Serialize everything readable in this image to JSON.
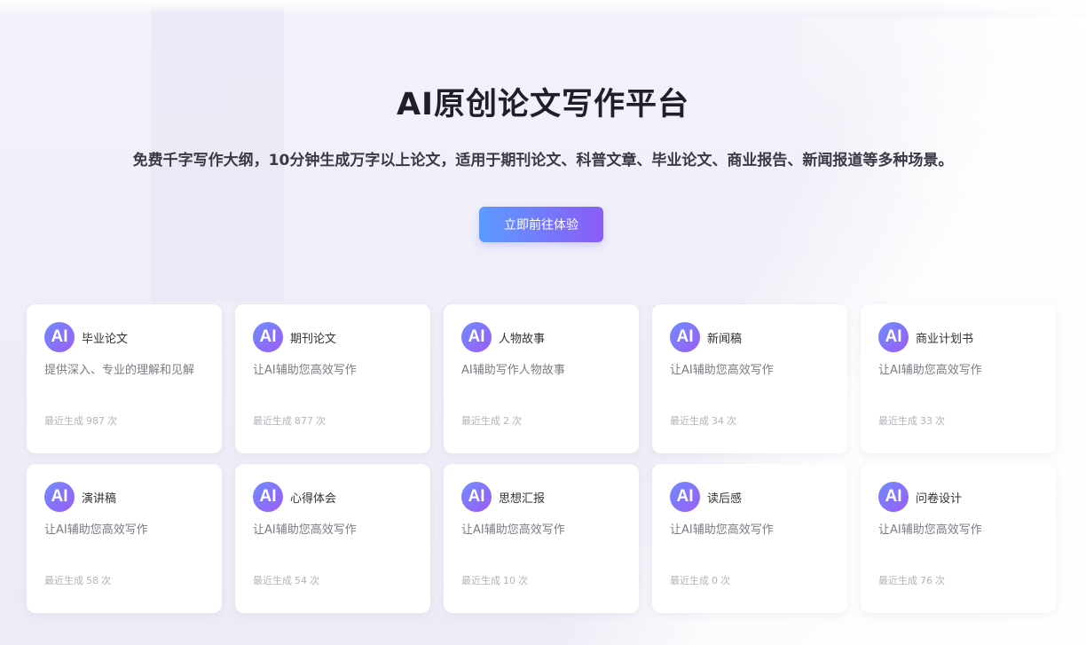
{
  "hero": {
    "title": "AI原创论文写作平台",
    "subtitle": "免费千字写作大纲，10分钟生成万字以上论文，适用于期刊论文、科普文章、毕业论文、商业报告、新闻报道等多种场景。",
    "cta_label": "立即前往体验"
  },
  "theme": {
    "accent_start": "#5b9bff",
    "accent_end": "#8a5cf6"
  },
  "cards": [
    {
      "icon": "AI",
      "title": "毕业论文",
      "desc": "提供深入、专业的理解和见解",
      "count_prefix": "最近生成",
      "count": "987",
      "count_suffix": "次"
    },
    {
      "icon": "AI",
      "title": "期刊论文",
      "desc": "让AI辅助您高效写作",
      "count_prefix": "最近生成",
      "count": "877",
      "count_suffix": "次"
    },
    {
      "icon": "AI",
      "title": "人物故事",
      "desc": "AI辅助写作人物故事",
      "count_prefix": "最近生成",
      "count": "2",
      "count_suffix": "次"
    },
    {
      "icon": "AI",
      "title": "新闻稿",
      "desc": "让AI辅助您高效写作",
      "count_prefix": "最近生成",
      "count": "34",
      "count_suffix": "次"
    },
    {
      "icon": "AI",
      "title": "商业计划书",
      "desc": "让AI辅助您高效写作",
      "count_prefix": "最近生成",
      "count": "33",
      "count_suffix": "次"
    },
    {
      "icon": "AI",
      "title": "演讲稿",
      "desc": "让AI辅助您高效写作",
      "count_prefix": "最近生成",
      "count": "58",
      "count_suffix": "次"
    },
    {
      "icon": "AI",
      "title": "心得体会",
      "desc": "让AI辅助您高效写作",
      "count_prefix": "最近生成",
      "count": "54",
      "count_suffix": "次"
    },
    {
      "icon": "AI",
      "title": "思想汇报",
      "desc": "让AI辅助您高效写作",
      "count_prefix": "最近生成",
      "count": "10",
      "count_suffix": "次"
    },
    {
      "icon": "AI",
      "title": "读后感",
      "desc": "让AI辅助您高效写作",
      "count_prefix": "最近生成",
      "count": "0",
      "count_suffix": "次"
    },
    {
      "icon": "AI",
      "title": "问卷设计",
      "desc": "让AI辅助您高效写作",
      "count_prefix": "最近生成",
      "count": "76",
      "count_suffix": "次"
    }
  ]
}
